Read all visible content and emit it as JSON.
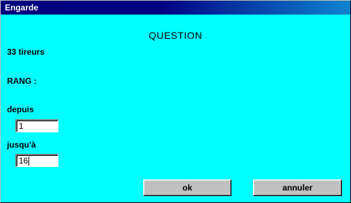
{
  "window": {
    "title": "Engarde"
  },
  "dialog": {
    "heading": "QUESTION",
    "count_label": "33 tireurs",
    "rank_label": "RANG :",
    "from_label": "depuis",
    "from_value": "1",
    "to_label": "jusqu'à",
    "to_value": "16"
  },
  "buttons": {
    "ok_label": "ok",
    "cancel_label": "annuler"
  },
  "colors": {
    "titlebar": "#000080",
    "background": "#00ffff",
    "button_face": "#c0c0c0"
  }
}
